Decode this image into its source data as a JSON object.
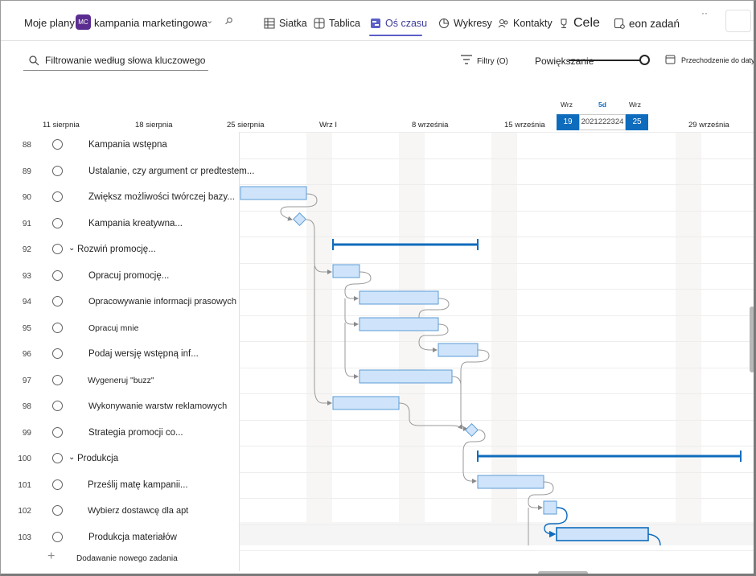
{
  "header": {
    "breadcrumb_root": "Moje plany &",
    "badge": "MC",
    "plan_name": "kampania marketingowa",
    "nav": [
      {
        "label": "Siatka",
        "icon": "grid-icon"
      },
      {
        "label": "Tablica",
        "icon": "board-icon"
      },
      {
        "label": "Oś czasu",
        "icon": "timeline-icon"
      },
      {
        "label": "Wykresy",
        "icon": "charts-icon"
      },
      {
        "label": "Kontakty",
        "icon": "people-icon"
      },
      {
        "label": "Cele",
        "icon": "trophy-icon"
      },
      {
        "label": "eon zadań",
        "icon": "task-icon"
      }
    ],
    "more": "··"
  },
  "toolbar": {
    "filter_placeholder": "Filtrowanie według słowa kluczowego",
    "filters_label": "Filtry (O)",
    "zoom_label": "Powiększanie",
    "goto_label": "Przechodzenie do daty"
  },
  "timeline": {
    "dates": [
      "11 sierpnia",
      "18 sierpnia",
      "25 sierpnia",
      "Wrz I",
      "8 września",
      "15 września",
      "29 września"
    ],
    "today_top_left": "Wrz",
    "today_top_mid": "5d",
    "today_top_right": "Wrz",
    "today_start": "19",
    "today_mid": "2021222324",
    "today_end": "25"
  },
  "tasks": [
    {
      "num": "88",
      "name": "Kampania wstępna"
    },
    {
      "num": "89",
      "name": "Ustalanie, czy argument cr predtestem..."
    },
    {
      "num": "90",
      "name": "Zwiększ możliwości twórczej bazy..."
    },
    {
      "num": "91",
      "name": "Kampania kreatywna..."
    },
    {
      "num": "92",
      "name": "Rozwiń promocję..."
    },
    {
      "num": "93",
      "name": "Opracuj promocję..."
    },
    {
      "num": "94",
      "name": "Opracowywanie informacji prasowych"
    },
    {
      "num": "95",
      "name": "Opracuj mnie"
    },
    {
      "num": "96",
      "name": "Podaj wersję wstępną inf..."
    },
    {
      "num": "97",
      "name": "Wygeneruj \"buzz\""
    },
    {
      "num": "98",
      "name": "Wykonywanie warstw reklamowych"
    },
    {
      "num": "99",
      "name": "Strategia promocji co..."
    },
    {
      "num": "100",
      "name": "Produkcja"
    },
    {
      "num": "101",
      "name": "Prześlij matę kampanii..."
    },
    {
      "num": "102",
      "name": "Wybierz dostawcę dla apt"
    },
    {
      "num": "103",
      "name": "Produkcja materiałów"
    }
  ],
  "add_task_label": "Dodawanie nowego zadania",
  "colors": {
    "accent": "#0f6cbd",
    "bar_fill": "#cfe4fa",
    "bar_border": "#5b9bd5",
    "brand": "#5b2d90"
  }
}
